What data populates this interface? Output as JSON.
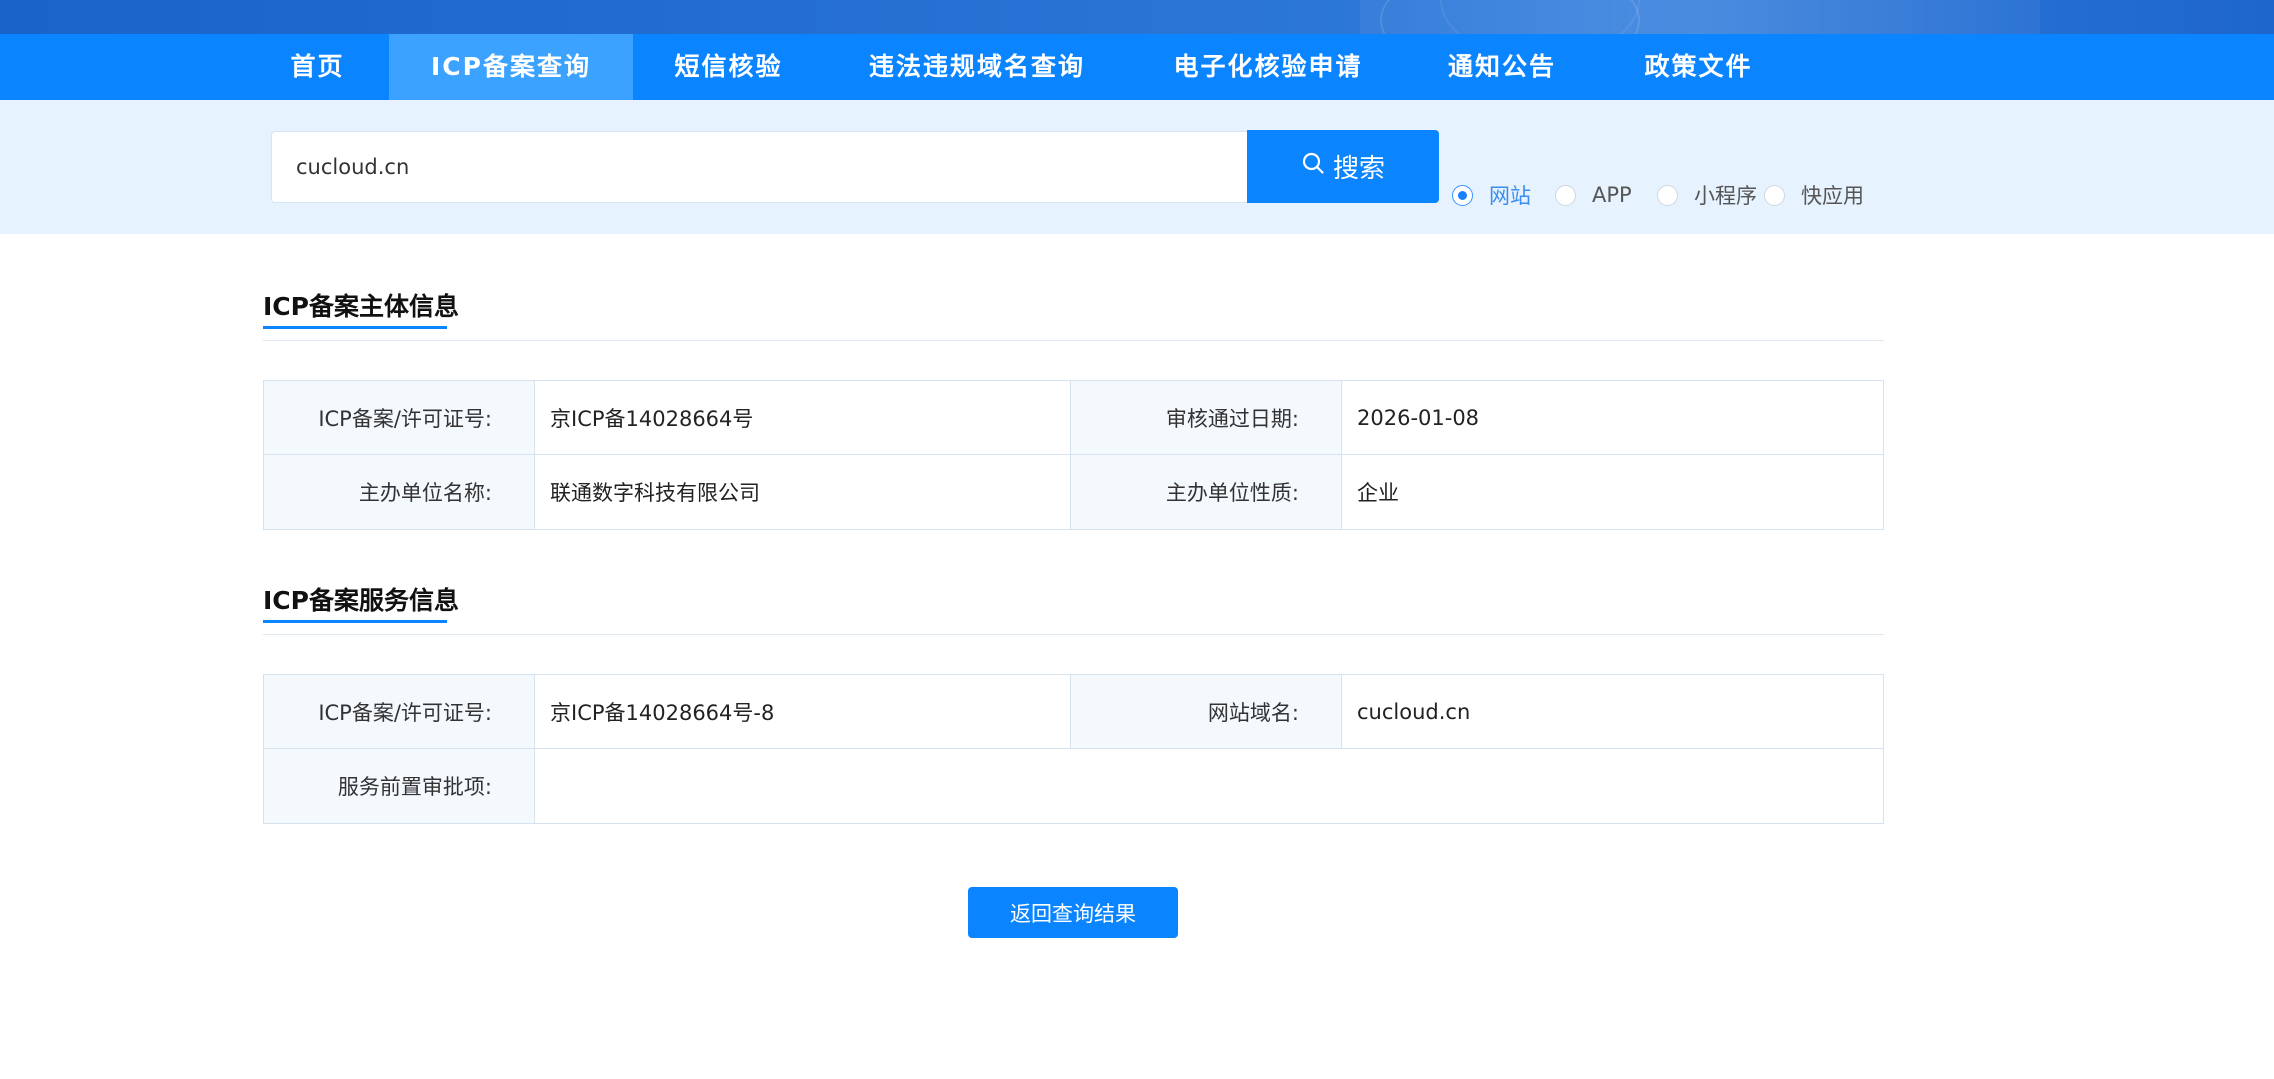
{
  "nav": {
    "items": [
      {
        "label": "首页"
      },
      {
        "label": "ICP备案查询"
      },
      {
        "label": "短信核验"
      },
      {
        "label": "违法违规域名查询"
      },
      {
        "label": "电子化核验申请"
      },
      {
        "label": "通知公告"
      },
      {
        "label": "政策文件"
      }
    ],
    "active_index": 1
  },
  "search": {
    "value": "cucloud.cn",
    "button_label": "搜索",
    "types": [
      {
        "label": "网站",
        "checked": true
      },
      {
        "label": "APP",
        "checked": false
      },
      {
        "label": "小程序",
        "checked": false
      },
      {
        "label": "快应用",
        "checked": false
      }
    ]
  },
  "subject_info": {
    "title": "ICP备案主体信息",
    "rows": [
      {
        "label1": "ICP备案/许可证号:",
        "value1": "京ICP备14028664号",
        "label2": "审核通过日期:",
        "value2": "2026-01-08"
      },
      {
        "label1": "主办单位名称:",
        "value1": "联通数字科技有限公司",
        "label2": "主办单位性质:",
        "value2": "企业"
      }
    ]
  },
  "service_info": {
    "title": "ICP备案服务信息",
    "row1": {
      "label1": "ICP备案/许可证号:",
      "value1": "京ICP备14028664号-8",
      "label2": "网站域名:",
      "value2": "cucloud.cn"
    },
    "row2": {
      "label": "服务前置审批项:",
      "value": ""
    }
  },
  "back_button_label": "返回查询结果",
  "colors": {
    "primary": "#0b84ff",
    "nav_active": "#3ca2ff",
    "search_band": "#e6f2fd",
    "label_bg": "#f4f9fe"
  },
  "icons": {
    "search_button": "search-icon"
  }
}
